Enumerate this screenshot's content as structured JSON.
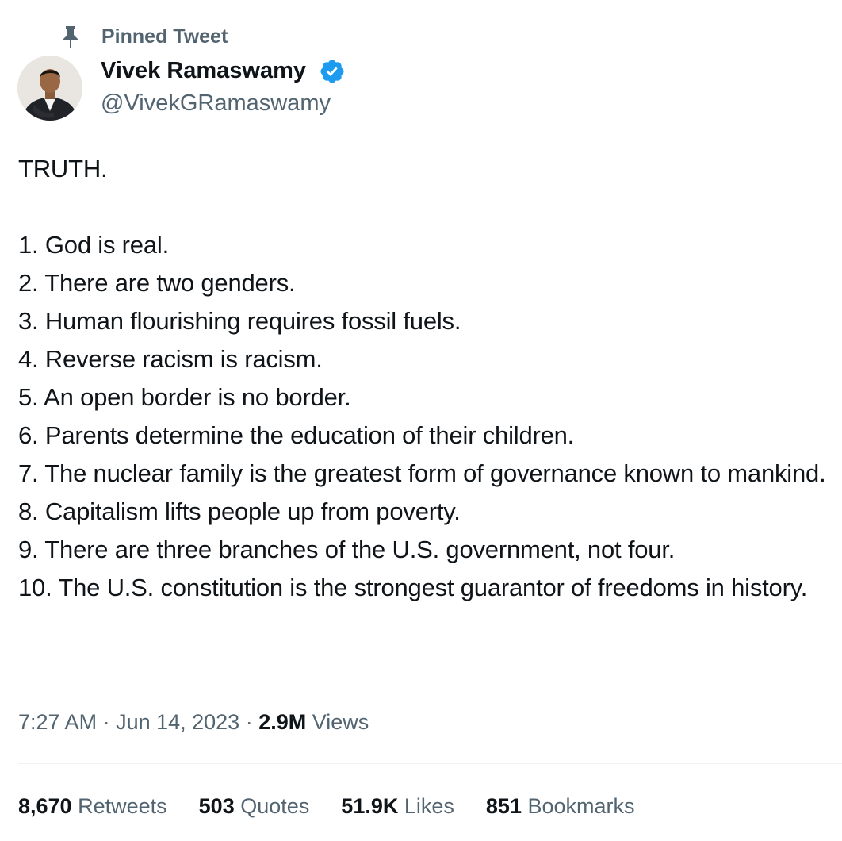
{
  "pinned": {
    "label": "Pinned Tweet",
    "icon": "pin-icon"
  },
  "author": {
    "name": "Vivek Ramaswamy",
    "handle": "@VivekGRamaswamy",
    "verified_icon": "verified-badge-icon",
    "verified_color": "#1d9bf0"
  },
  "tweet": {
    "heading": "TRUTH.",
    "lines": [
      "1. God is real.",
      "2. There are two genders.",
      "3. Human flourishing requires fossil fuels.",
      "4. Reverse racism is racism.",
      "5. An open border is no border.",
      "6. Parents determine the education of their children.",
      "7. The nuclear family is the greatest form of governance known to mankind.",
      "8. Capitalism lifts people up from poverty.",
      "9. There are three branches of the U.S. government, not four.",
      "10. The U.S. constitution is the strongest guarantor of freedoms in history."
    ]
  },
  "meta": {
    "time": "7:27 AM",
    "separator": " · ",
    "date": "Jun 14, 2023",
    "views_count": "2.9M",
    "views_label": "Views"
  },
  "stats": {
    "retweets_count": "8,670",
    "retweets_label": "Retweets",
    "quotes_count": "503",
    "quotes_label": "Quotes",
    "likes_count": "51.9K",
    "likes_label": "Likes",
    "bookmarks_count": "851",
    "bookmarks_label": "Bookmarks"
  },
  "colors": {
    "text_primary": "#0f1419",
    "text_secondary": "#536471",
    "divider": "#eff3f4"
  }
}
